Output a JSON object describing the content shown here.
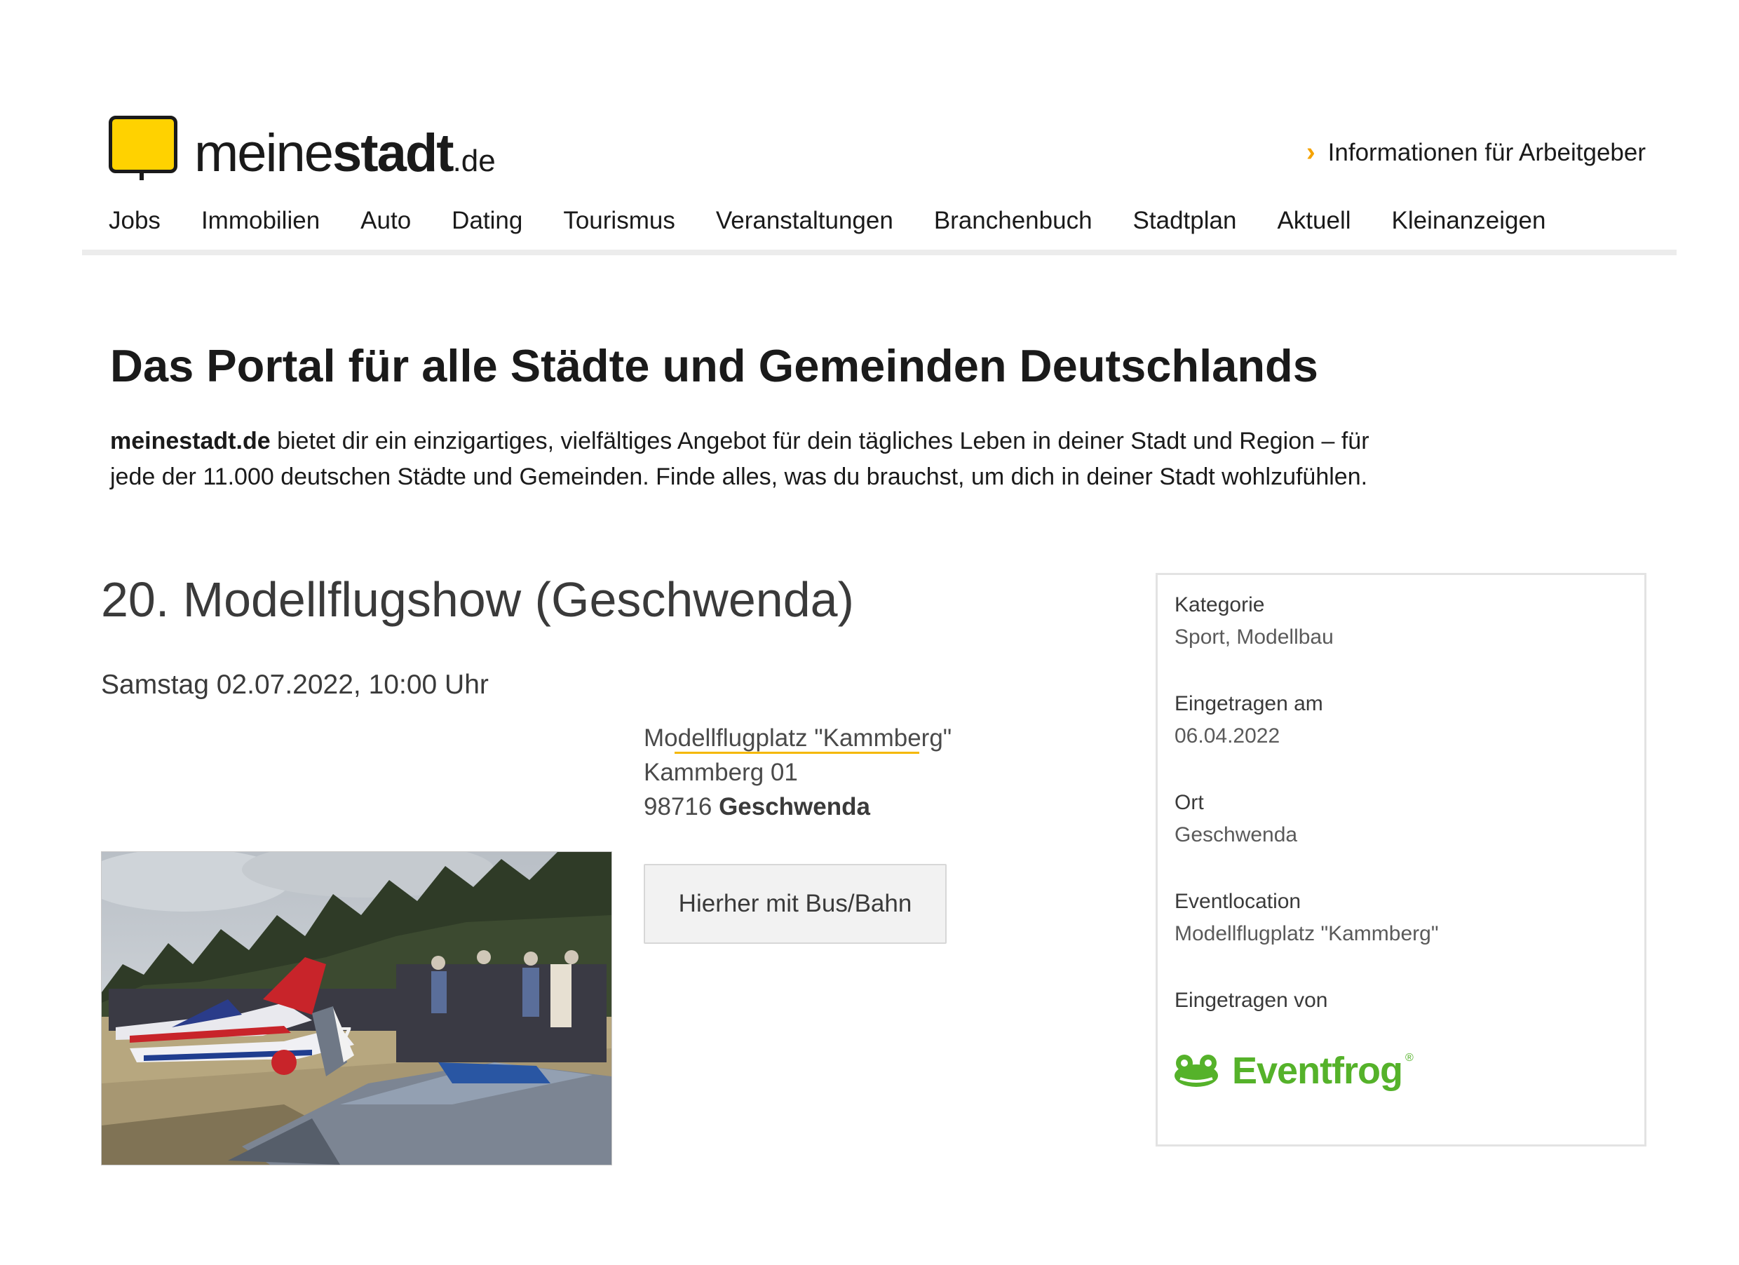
{
  "header": {
    "logo": {
      "part_light": "meine",
      "part_bold": "stadt",
      "part_tld": ".de"
    },
    "employer_link": "Informationen für Arbeitgeber",
    "nav": [
      "Jobs",
      "Immobilien",
      "Auto",
      "Dating",
      "Tourismus",
      "Veranstaltungen",
      "Branchenbuch",
      "Stadtplan",
      "Aktuell",
      "Kleinanzeigen"
    ]
  },
  "intro": {
    "title": "Das Portal für alle Städte und Gemeinden Deutschlands",
    "brand": "meinestadt.de",
    "text_line1": " bietet dir ein einzigartiges, vielfältiges Angebot für dein tägliches Leben in deiner Stadt und Region – für",
    "text_line2": "jede der 11.000 deutschen Städte und Gemeinden. Finde alles, was du brauchst, um dich in deiner Stadt wohlzufühlen."
  },
  "event": {
    "title": "20. Modellflugshow (Geschwenda)",
    "date": "Samstag 02.07.2022, 10:00 Uhr",
    "address": {
      "venue": "Modellflugplatz \"Kammberg\"",
      "street": "Kammberg 01",
      "zip": "98716",
      "city": "Geschwenda"
    },
    "transit_button": "Hierher mit Bus/Bahn"
  },
  "info": {
    "category_label": "Kategorie",
    "category_value": "Sport, Modellbau",
    "registered_label": "Eingetragen am",
    "registered_value": "06.04.2022",
    "place_label": "Ort",
    "place_value": "Geschwenda",
    "location_label": "Eventlocation",
    "location_value": "Modellflugplatz \"Kammberg\"",
    "by_label": "Eingetragen von",
    "by_brand": "Eventfrog",
    "by_brand_mark": "®"
  },
  "colors": {
    "accent_yellow": "#ffd200",
    "chevron": "#f5a300",
    "eventfrog_green": "#55b22a"
  }
}
